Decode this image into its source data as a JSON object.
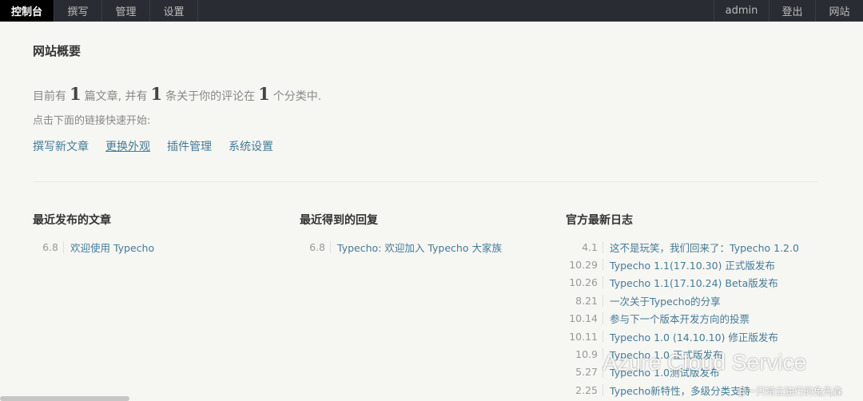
{
  "nav": {
    "left": [
      "控制台",
      "撰写",
      "管理",
      "设置"
    ],
    "right": [
      "admin",
      "登出",
      "网站"
    ]
  },
  "overview": {
    "title": "网站概要",
    "stats": {
      "prefix": "目前有",
      "posts": "1",
      "posts_text": "篇文章, 并有",
      "comments": "1",
      "comments_text": "条关于你的评论在",
      "categories": "1",
      "categories_text": "个分类中."
    },
    "quick_hint": "点击下面的链接快速开始:",
    "quick_links": [
      "撰写新文章",
      "更换外观",
      "插件管理",
      "系统设置"
    ]
  },
  "recent_posts": {
    "title": "最近发布的文章",
    "items": [
      {
        "date": "6.8",
        "title": "欢迎使用 Typecho"
      }
    ]
  },
  "recent_replies": {
    "title": "最近得到的回复",
    "items": [
      {
        "date": "6.8",
        "author": "Typecho",
        "text": ": 欢迎加入 Typecho 大家族"
      }
    ]
  },
  "official_log": {
    "title": "官方最新日志",
    "items": [
      {
        "date": "4.1",
        "title": "这不是玩笑，我们回来了：Typecho 1.2.0"
      },
      {
        "date": "10.29",
        "title": "Typecho 1.1(17.10.30) 正式版发布"
      },
      {
        "date": "10.26",
        "title": "Typecho 1.1(17.10.24) Beta版发布"
      },
      {
        "date": "8.21",
        "title": "一次关于Typecho的分享"
      },
      {
        "date": "10.14",
        "title": "参与下一个版本开发方向的投票"
      },
      {
        "date": "10.11",
        "title": "Typecho 1.0 (14.10.10) 修正版发布"
      },
      {
        "date": "10.9",
        "title": "Typecho 1.0 正式版发布"
      },
      {
        "date": "5.27",
        "title": "Typecho 1.0测试版发布"
      },
      {
        "date": "2.25",
        "title": "Typecho新特性，多级分类支持"
      }
    ]
  },
  "watermark": {
    "text": "Azure Cloud Service",
    "sub": "@一只特立独行的兔先森"
  }
}
